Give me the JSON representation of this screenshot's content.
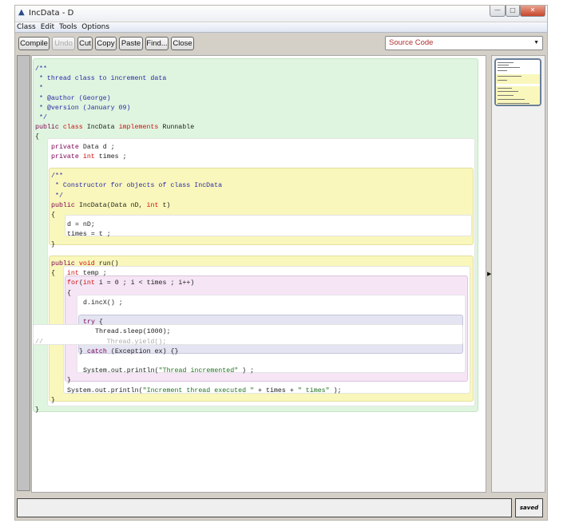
{
  "window": {
    "title": "IncData - D",
    "controls": [
      "minimize",
      "maximize",
      "close"
    ]
  },
  "menu": [
    "Class",
    "Edit",
    "Tools",
    "Options"
  ],
  "toolbar": {
    "buttons": [
      {
        "label": "Compile",
        "enabled": true
      },
      {
        "label": "Undo",
        "enabled": false
      },
      {
        "label": "Cut",
        "enabled": true
      },
      {
        "label": "Copy",
        "enabled": true
      },
      {
        "label": "Paste",
        "enabled": true
      },
      {
        "label": "Find...",
        "enabled": true
      },
      {
        "label": "Close",
        "enabled": true
      }
    ],
    "view": "Source Code"
  },
  "status": {
    "message": "",
    "saved": "saved"
  },
  "code": [
    [
      [
        0,
        "cm",
        "/**"
      ]
    ],
    [
      [
        0,
        "cm",
        " * thread class to increment data"
      ]
    ],
    [
      [
        0,
        "cm",
        " *"
      ]
    ],
    [
      [
        0,
        "cm",
        " * @author (George)"
      ]
    ],
    [
      [
        0,
        "cm",
        " * @version (January 09)"
      ]
    ],
    [
      [
        0,
        "cm",
        " */"
      ]
    ],
    [
      [
        0,
        "kw1",
        "public "
      ],
      [
        0,
        "kw2",
        "class "
      ],
      [
        0,
        "",
        "IncData "
      ],
      [
        0,
        "kw2",
        "implements "
      ],
      [
        0,
        "",
        "Runnable"
      ]
    ],
    [
      [
        0,
        "",
        "{"
      ]
    ],
    [
      [
        4,
        "kw1",
        "private "
      ],
      [
        4,
        "",
        "Data d ;"
      ]
    ],
    [
      [
        4,
        "kw1",
        "private "
      ],
      [
        4,
        "kw2",
        "int "
      ],
      [
        4,
        "",
        "times ;"
      ]
    ],
    [],
    [
      [
        4,
        "cm",
        "/**"
      ]
    ],
    [
      [
        4,
        "cm",
        " * Constructor for objects of class IncData"
      ]
    ],
    [
      [
        4,
        "cm",
        " */"
      ]
    ],
    [
      [
        4,
        "kw1",
        "public "
      ],
      [
        4,
        "",
        "IncData(Data nD, "
      ],
      [
        4,
        "kw2",
        "int "
      ],
      [
        4,
        "",
        "t)"
      ]
    ],
    [
      [
        4,
        "",
        "{"
      ]
    ],
    [
      [
        8,
        "",
        "d = nD;"
      ]
    ],
    [
      [
        8,
        "",
        "times = t ;"
      ]
    ],
    [
      [
        4,
        "",
        "}"
      ]
    ],
    [],
    [
      [
        4,
        "kw1",
        "public "
      ],
      [
        4,
        "kw2",
        "void "
      ],
      [
        4,
        "",
        "run()"
      ]
    ],
    [
      [
        4,
        "",
        "{   "
      ],
      [
        4,
        "kw2",
        "int "
      ],
      [
        4,
        "",
        "temp ;"
      ]
    ],
    [
      [
        8,
        "kw2",
        "for"
      ],
      [
        8,
        "",
        "("
      ],
      [
        8,
        "kw2",
        "int "
      ],
      [
        8,
        "",
        "i = 0 ; i < times ; i++)"
      ]
    ],
    [
      [
        8,
        "",
        "{"
      ]
    ],
    [
      [
        12,
        "",
        "d.incX() ;"
      ]
    ],
    [],
    [
      [
        12,
        "kw1",
        "try "
      ],
      [
        12,
        "",
        "{"
      ]
    ],
    [
      [
        15,
        "",
        "Thread.sleep(1000);"
      ]
    ],
    [
      [
        0,
        "dim",
        "//                Thread.yield();"
      ]
    ],
    [
      [
        11,
        "",
        "} "
      ],
      [
        11,
        "kw1",
        "catch "
      ],
      [
        11,
        "",
        "(Exception ex) {}"
      ]
    ],
    [],
    [
      [
        12,
        "",
        "System.out.println("
      ],
      [
        12,
        "str",
        "\"Thread incremented\""
      ],
      [
        12,
        "",
        " ) ;"
      ]
    ],
    [
      [
        8,
        "",
        "}"
      ]
    ],
    [
      [
        8,
        "",
        "System.out.println("
      ],
      [
        8,
        "str",
        "\"Increment thread executed \""
      ],
      [
        8,
        "",
        " + times + "
      ],
      [
        8,
        "str",
        "\" times\""
      ],
      [
        8,
        "",
        " );"
      ]
    ],
    [
      [
        4,
        "",
        "}"
      ]
    ],
    [
      [
        0,
        "",
        "}"
      ]
    ]
  ]
}
